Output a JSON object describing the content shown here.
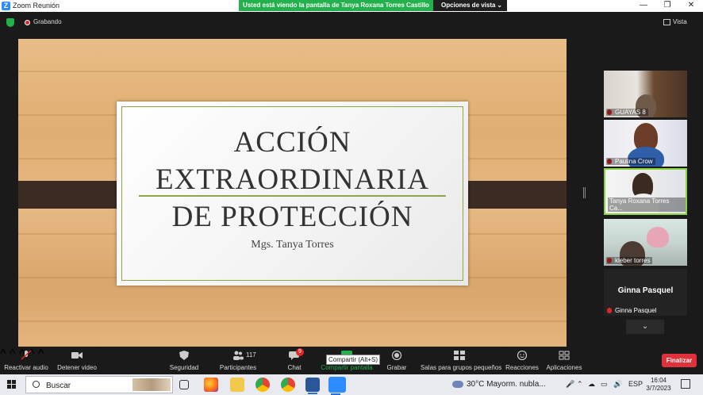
{
  "window": {
    "title": "Zoom Reunión",
    "banner": "Usted está viendo la pantalla de Tanya Roxana Torres Castillo",
    "view_options": "Opciones de vista",
    "minimize": "—",
    "restore": "❐",
    "close": "✕"
  },
  "topbar": {
    "recording": "Grabando",
    "view": "Vista"
  },
  "slide": {
    "title_line1": "ACCIÓN",
    "title_line2": "EXTRAORDINARIA",
    "title_line3": "DE PROTECCIÓN",
    "author": "Mgs. Tanya Torres",
    "colors": {
      "wood": "#e2b47c",
      "strip": "#3b2b23",
      "accent": "#8aa845"
    }
  },
  "participants": [
    {
      "name": "GUAYAS 8",
      "muted": true
    },
    {
      "name": "Paulina Crow",
      "muted": true
    },
    {
      "name": "Tanya Roxana Torres Ca...",
      "muted": false,
      "active": true
    },
    {
      "name": "kleber torres",
      "muted": true
    },
    {
      "name": "Ginna Pasquel",
      "big_label": "Ginna Pasquel",
      "muted": true
    }
  ],
  "toolbar": {
    "unmute": "Reactivar audio",
    "stop_video": "Detener video",
    "security": "Seguridad",
    "participants": "Participantes",
    "participants_count": "117",
    "chat": "Chat",
    "chat_badge": "9",
    "share": "Compartir pantalla",
    "share_tooltip": "Compartir (Alt+S)",
    "record": "Grabar",
    "breakout": "Salas para grupos pequeños",
    "reactions": "Reacciones",
    "apps": "Aplicaciones",
    "end": "Finalizar",
    "caret": "^"
  },
  "taskbar": {
    "search_placeholder": "Buscar",
    "weather": "30°C  Mayorm. nubla...",
    "language": "ESP",
    "time": "16:04",
    "date": "3/7/2023"
  }
}
